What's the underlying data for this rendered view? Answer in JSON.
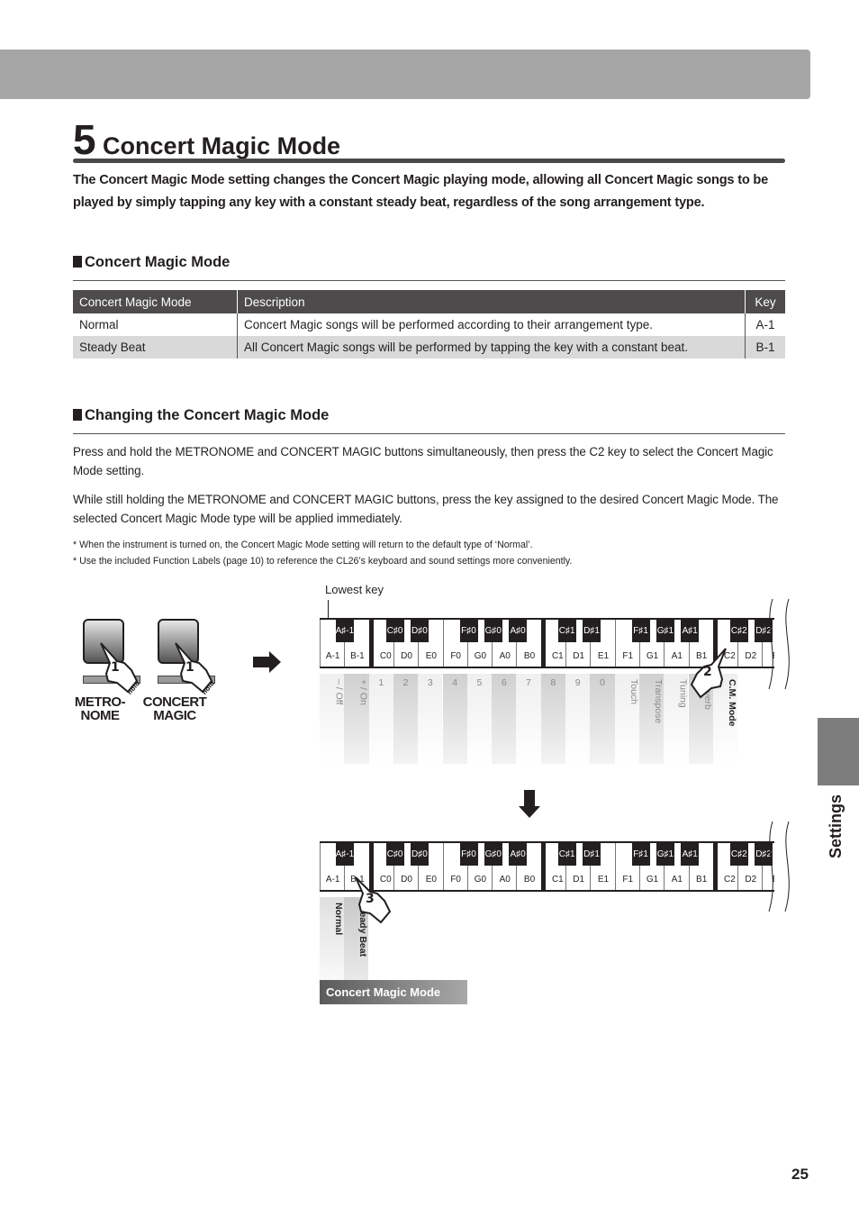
{
  "chapter": {
    "number": "5",
    "title": "Concert Magic Mode"
  },
  "intro": "The Concert Magic Mode setting changes the Concert Magic playing mode, allowing all Concert Magic songs to be played by simply tapping any key with a constant steady beat, regardless of the song arrangement type.",
  "section1": {
    "heading": "Concert Magic Mode",
    "table": {
      "headers": [
        "Concert Magic Mode",
        "Description",
        "Key"
      ],
      "rows": [
        {
          "mode": "Normal",
          "description": "Concert Magic songs will be performed according to their arrangement type.",
          "key": "A-1"
        },
        {
          "mode": "Steady Beat",
          "description": "All Concert Magic songs will be performed by tapping the key with a constant beat.",
          "key": "B-1"
        }
      ]
    }
  },
  "section2": {
    "heading": "Changing the Concert Magic Mode",
    "paragraphs": [
      "Press and hold the METRONOME and CONCERT MAGIC buttons simultaneously, then press the C2 key to select the Concert Magic Mode setting.",
      "While still holding the METRONOME and CONCERT MAGIC buttons, press the key assigned to the desired Concert Magic Mode. The selected Concert Magic Mode type will be applied immediately."
    ],
    "notes": [
      "* When the instrument is turned on, the Concert Magic Mode setting will return to the default type of ‘Normal’.",
      "* Use the included Function Labels (page 10) to reference the CL26’s keyboard and sound settings more conveniently."
    ]
  },
  "diagram": {
    "buttons": [
      {
        "label_line1": "METRO-",
        "label_line2": "NOME",
        "step": "1",
        "action": "hold"
      },
      {
        "label_line1": "CONCERT",
        "label_line2": "MAGIC",
        "step": "1",
        "action": "hold"
      }
    ],
    "lowest_key_label": "Lowest key",
    "white_keys": [
      "A-1",
      "B-1",
      "C0",
      "D0",
      "E0",
      "F0",
      "G0",
      "A0",
      "B0",
      "C1",
      "D1",
      "E1",
      "F1",
      "G1",
      "A1",
      "B1",
      "C2",
      "D2",
      "E"
    ],
    "black_keys": [
      "A♯-1",
      "C♯0",
      "D♯0",
      "F♯0",
      "G♯0",
      "A♯0",
      "C♯1",
      "D♯1",
      "F♯1",
      "G♯1",
      "A♯1",
      "C♯2",
      "D♯2"
    ],
    "function_labels": [
      "– / Off",
      "+ / On",
      "1",
      "2",
      "3",
      "4",
      "5",
      "6",
      "7",
      "8",
      "9",
      "0",
      "Touch",
      "Transpose",
      "Tuning",
      "Reverb",
      "C.M. Mode"
    ],
    "step2": "2",
    "step3": "3",
    "mode_labels": [
      "Normal",
      "Steady Beat"
    ],
    "mode_bar_label": "Concert Magic Mode"
  },
  "side_tab": "Settings",
  "page_number": "25"
}
